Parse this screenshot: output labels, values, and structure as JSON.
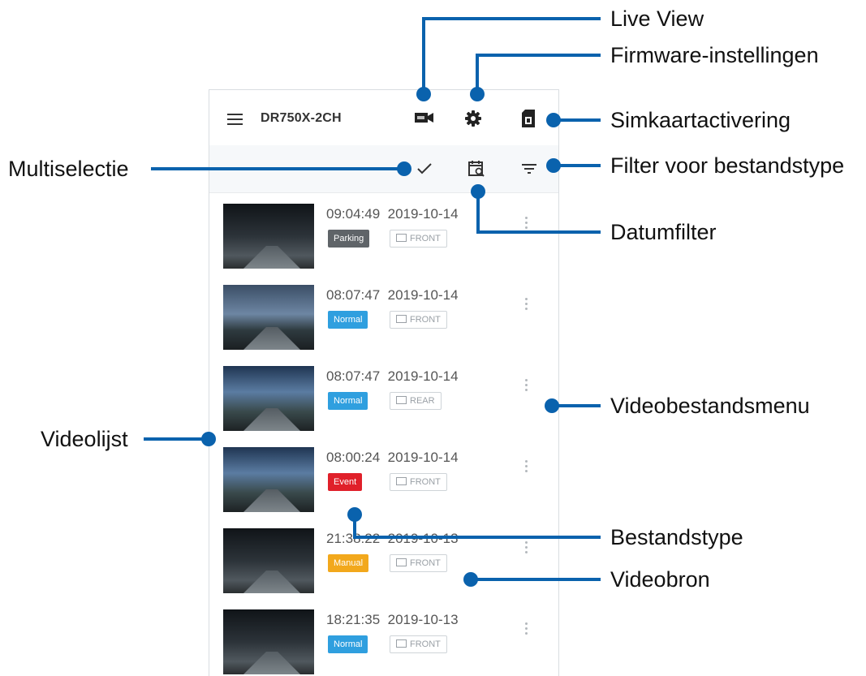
{
  "app": {
    "title": "DR750X-2CH"
  },
  "toolbar_icons": [
    "live-view-icon",
    "settings-icon",
    "sim-card-icon",
    "checkmark-icon",
    "calendar-search-icon",
    "filter-icon"
  ],
  "videos": [
    {
      "time": "09:04:49  2019-10-14",
      "type": "Parking",
      "type_color": "#5f6468",
      "source": "FRONT"
    },
    {
      "time": "08:07:47  2019-10-14",
      "type": "Normal",
      "type_color": "#2f9fdf",
      "source": "FRONT"
    },
    {
      "time": "08:07:47  2019-10-14",
      "type": "Normal",
      "type_color": "#2f9fdf",
      "source": "REAR"
    },
    {
      "time": "08:00:24  2019-10-14",
      "type": "Event",
      "type_color": "#e0202a",
      "source": "FRONT"
    },
    {
      "time": "21:38:22  2019-10-13",
      "type": "Manual",
      "type_color": "#f2a81c",
      "source": "FRONT"
    },
    {
      "time": "18:21:35  2019-10-13",
      "type": "Normal",
      "type_color": "#2f9fdf",
      "source": "FRONT"
    }
  ],
  "callouts": {
    "live_view": "Live View",
    "firmware": "Firmware-instellingen",
    "sim": "Simkaartactivering",
    "multiselect": "Multiselectie",
    "file_type_filter": "Filter voor bestandstype",
    "date_filter": "Datumfilter",
    "video_menu": "Videobestandsmenu",
    "video_list": "Videolijst",
    "file_type": "Bestandstype",
    "video_source": "Videobron"
  },
  "accent_color": "#0a62ad"
}
